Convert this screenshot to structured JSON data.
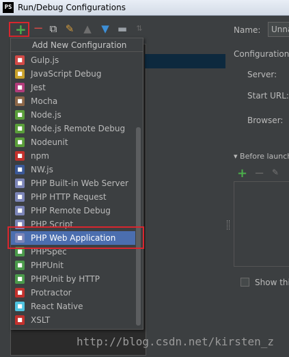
{
  "window": {
    "title": "Run/Debug Configurations",
    "app_icon": "PS"
  },
  "toolbar": {
    "icons": [
      "plus-icon",
      "minus-icon",
      "copy-icon",
      "wrench-icon",
      "arrow-up-icon",
      "arrow-down-icon",
      "folder-icon",
      "sort-icon"
    ]
  },
  "popup": {
    "header": "Add New Configuration",
    "items": [
      {
        "label": "Gulp.js",
        "icon": "gulp-icon",
        "color": "#d34a47"
      },
      {
        "label": "JavaScript Debug",
        "icon": "js-debug-icon",
        "color": "#c8a02a"
      },
      {
        "label": "Jest",
        "icon": "jest-icon",
        "color": "#b23b7a"
      },
      {
        "label": "Mocha",
        "icon": "mocha-icon",
        "color": "#8d6748"
      },
      {
        "label": "Node.js",
        "icon": "nodejs-icon",
        "color": "#5a9e3a"
      },
      {
        "label": "Node.js Remote Debug",
        "icon": "nodejs-remote-icon",
        "color": "#5a9e3a"
      },
      {
        "label": "Nodeunit",
        "icon": "nodeunit-icon",
        "color": "#5a9e3a"
      },
      {
        "label": "npm",
        "icon": "npm-icon",
        "color": "#c2312d"
      },
      {
        "label": "NW.js",
        "icon": "nwjs-icon",
        "color": "#3b5998"
      },
      {
        "label": "PHP Built-in Web Server",
        "icon": "php-server-icon",
        "color": "#7c85b8"
      },
      {
        "label": "PHP HTTP Request",
        "icon": "php-http-icon",
        "color": "#7c85b8"
      },
      {
        "label": "PHP Remote Debug",
        "icon": "php-remote-icon",
        "color": "#7c85b8"
      },
      {
        "label": "PHP Script",
        "icon": "php-script-icon",
        "color": "#7c85b8"
      },
      {
        "label": "PHP Web Application",
        "icon": "php-web-icon",
        "color": "#7c85b8",
        "selected": true
      },
      {
        "label": "PHPSpec",
        "icon": "phpspec-icon",
        "color": "#4b9a4b"
      },
      {
        "label": "PHPUnit",
        "icon": "phpunit-icon",
        "color": "#4b9a4b"
      },
      {
        "label": "PHPUnit by HTTP",
        "icon": "phpunit-http-icon",
        "color": "#4b9a4b"
      },
      {
        "label": "Protractor",
        "icon": "protractor-icon",
        "color": "#c2312d"
      },
      {
        "label": "React Native",
        "icon": "react-icon",
        "color": "#4fc3e0"
      },
      {
        "label": "XSLT",
        "icon": "xslt-icon",
        "color": "#c2312d"
      }
    ]
  },
  "right_panel": {
    "name_label": "Name:",
    "name_value": "Unna",
    "configuration_heading": "Configuration",
    "server_label": "Server:",
    "start_url_label": "Start URL:",
    "browser_label": "Browser:",
    "before_launch_label": "Before launch",
    "show_label": "Show thi"
  },
  "watermark": "http://blog.csdn.net/kirsten_z"
}
